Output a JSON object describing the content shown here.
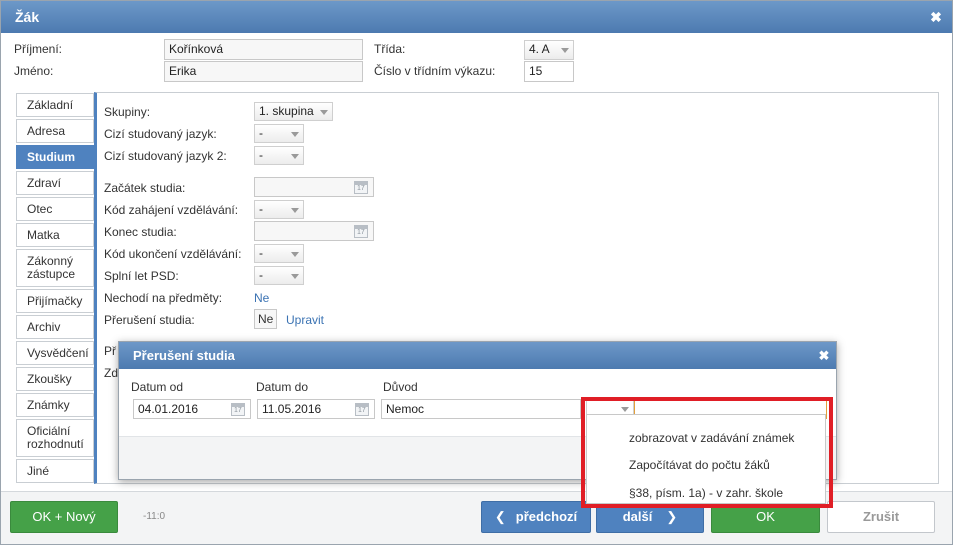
{
  "window": {
    "title": "Žák"
  },
  "header_fields": {
    "prijmeni_label": "Příjmení:",
    "prijmeni_value": "Kořínková",
    "jmeno_label": "Jméno:",
    "jmeno_value": "Erika",
    "trida_label": "Třída:",
    "trida_value": "4. A",
    "cislo_label": "Číslo v třídním výkazu:",
    "cislo_value": "15"
  },
  "tabs": [
    {
      "label": "Základní"
    },
    {
      "label": "Adresa"
    },
    {
      "label": "Studium",
      "active": true
    },
    {
      "label": "Zdraví"
    },
    {
      "label": "Otec"
    },
    {
      "label": "Matka"
    },
    {
      "label": "Zákonný zástupce"
    },
    {
      "label": "Přijímačky"
    },
    {
      "label": "Archiv"
    },
    {
      "label": "Vysvědčení"
    },
    {
      "label": "Zkoušky"
    },
    {
      "label": "Známky"
    },
    {
      "label": "Oficiální rozhodnutí"
    },
    {
      "label": "Jiné"
    }
  ],
  "studium": {
    "skupiny_label": "Skupiny:",
    "skupiny_value": "1. skupina",
    "jazyk_label": "Cizí studovaný jazyk:",
    "jazyk_value": "-",
    "jazyk2_label": "Cizí studovaný jazyk 2:",
    "jazyk2_value": "-",
    "zacatek_label": "Začátek studia:",
    "kod_zahajeni_label": "Kód zahájení vzdělávání:",
    "kod_zahajeni_value": "-",
    "konec_label": "Konec studia:",
    "kod_ukonceni_label": "Kód ukončení vzdělávání:",
    "kod_ukonceni_value": "-",
    "psd_label": "Splní let PSD:",
    "psd_value": "-",
    "nechodi_label": "Nechodí na předměty:",
    "nechodi_value": "Ne",
    "preruseni_label": "Přerušení studia:",
    "preruseni_value": "Ne",
    "upravit_link": "Upravit",
    "partial_label_1": "Př",
    "partial_label_2": "Zd"
  },
  "subdialog": {
    "title": "Přerušení studia",
    "datum_od_label": "Datum od",
    "datum_od_value": "04.01.2016",
    "datum_do_label": "Datum do",
    "datum_do_value": "11.05.2016",
    "duvod_label": "Důvod",
    "duvod_value": "Nemoc"
  },
  "dropdown": {
    "selected": "",
    "items": [
      "zobrazovat v zadávání známek",
      "Započítávat do počtu žáků",
      "§38, písm. 1a) - v zahr. škole"
    ]
  },
  "footer": {
    "ok_novy": "OK + Nový",
    "counter": "-11:0",
    "predchozi": "předchozí",
    "dalsi": "další",
    "ok": "OK",
    "zrusit": "Zrušit"
  },
  "icons": {
    "calendar_glyph": "17"
  },
  "colors": {
    "accent_blue": "#4f82bf",
    "ok_green": "#45a148",
    "highlight_red": "#e01e26"
  }
}
